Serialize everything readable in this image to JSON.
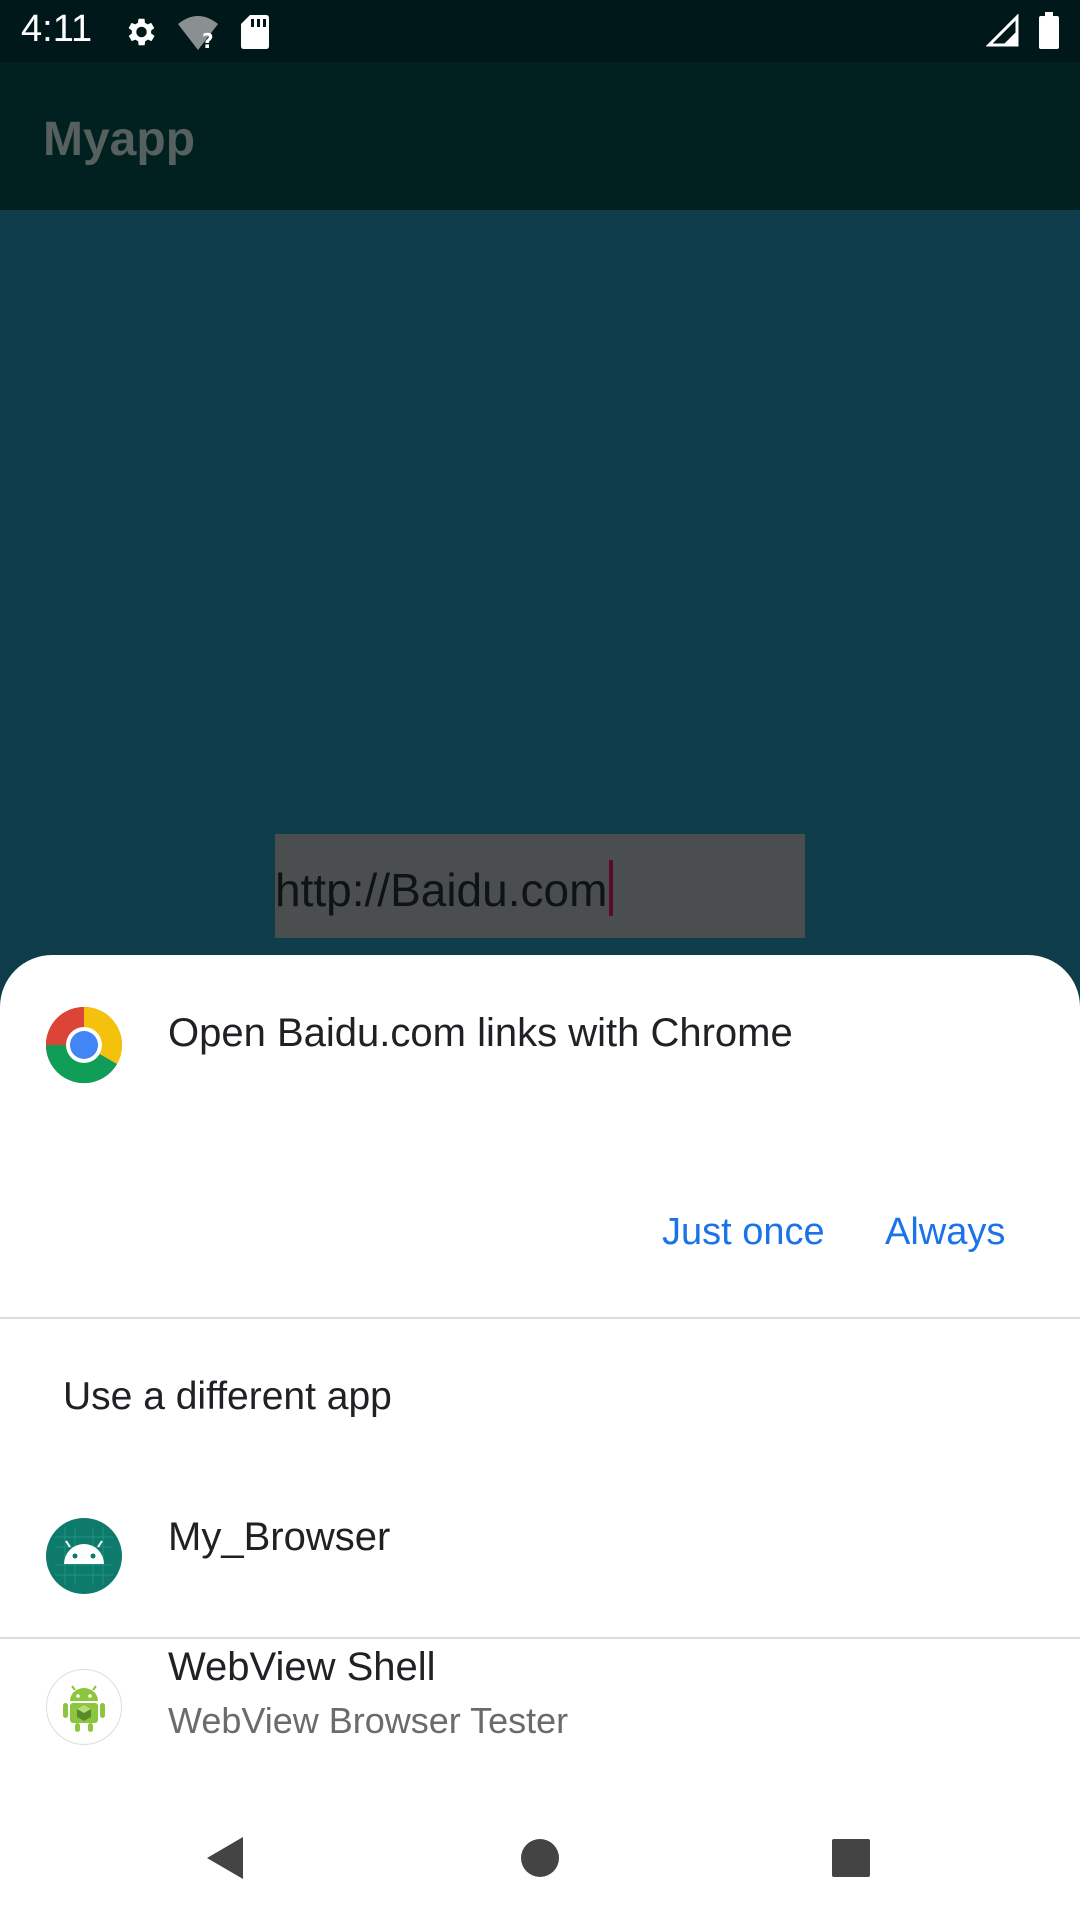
{
  "status_bar": {
    "time": "4:11",
    "icons": [
      "settings-gear-icon",
      "wifi-unknown-icon",
      "sd-card-icon",
      "cell-signal-icon",
      "battery-icon"
    ]
  },
  "app_bar": {
    "title": "Myapp"
  },
  "url_field": {
    "value": "http://Baidu.com"
  },
  "sheet": {
    "header_icon": "chrome-icon",
    "header_text": "Open Baidu.com links with Chrome",
    "just_once_label": "Just once",
    "always_label": "Always",
    "alt_heading": "Use a different app",
    "apps": [
      {
        "icon": "android-app-icon",
        "name": "My_Browser",
        "subtitle": ""
      },
      {
        "icon": "webview-shell-icon",
        "name": "WebView Shell",
        "subtitle": "WebView Browser Tester"
      }
    ]
  },
  "nav_bar": {
    "icons": [
      "back-triangle-icon",
      "home-circle-icon",
      "recents-square-icon"
    ]
  },
  "colors": {
    "accent": "#1a73e8",
    "status_bar_bg": "#00181a",
    "app_bar_bg": "#00211f",
    "scrim_bg": "#0f3c4a"
  }
}
